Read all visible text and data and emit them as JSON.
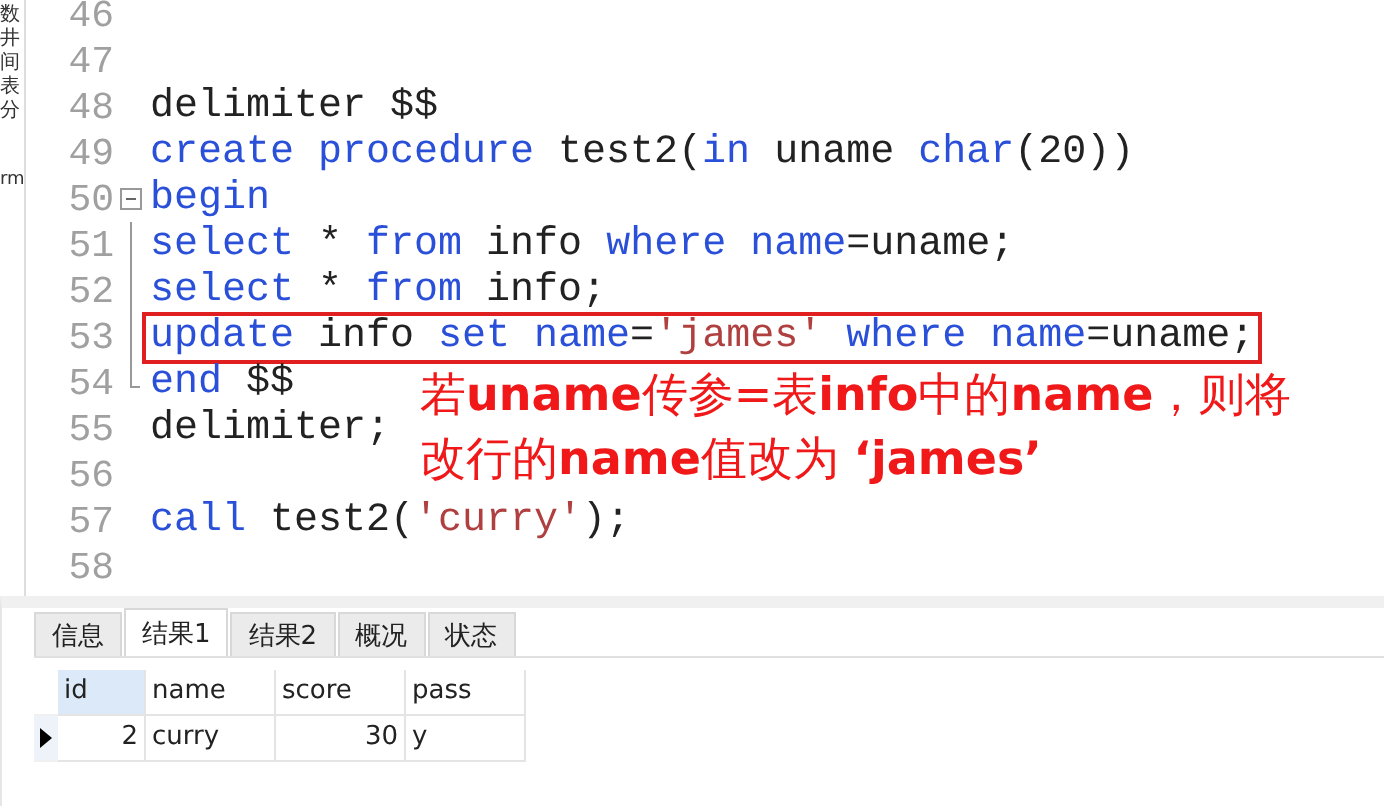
{
  "side_strip": [
    "数",
    "井",
    "间",
    "表",
    "分",
    "rm"
  ],
  "editor": {
    "lines": [
      {
        "number": "46"
      },
      {
        "number": "47"
      },
      {
        "number": "48",
        "tokens": [
          {
            "kind": "plain",
            "text": "delimiter $$"
          }
        ]
      },
      {
        "number": "49",
        "tokens": [
          {
            "kind": "keyword",
            "text": "create procedure"
          },
          {
            "kind": "plain",
            "text": " test2("
          },
          {
            "kind": "keyword",
            "text": "in"
          },
          {
            "kind": "plain",
            "text": " uname "
          },
          {
            "kind": "keyword",
            "text": "char"
          },
          {
            "kind": "plain",
            "text": "(20))"
          }
        ]
      },
      {
        "number": "50",
        "fold_start": true,
        "tokens": [
          {
            "kind": "keyword",
            "text": "begin"
          }
        ]
      },
      {
        "number": "51",
        "in_fold": true,
        "tokens": [
          {
            "kind": "keyword",
            "text": "select"
          },
          {
            "kind": "plain",
            "text": " * "
          },
          {
            "kind": "keyword",
            "text": "from"
          },
          {
            "kind": "plain",
            "text": " info "
          },
          {
            "kind": "keyword",
            "text": "where name"
          },
          {
            "kind": "plain",
            "text": "=uname;"
          }
        ]
      },
      {
        "number": "52",
        "in_fold": true,
        "tokens": [
          {
            "kind": "keyword",
            "text": "select"
          },
          {
            "kind": "plain",
            "text": " * "
          },
          {
            "kind": "keyword",
            "text": "from"
          },
          {
            "kind": "plain",
            "text": " info;"
          }
        ]
      },
      {
        "number": "53",
        "in_fold": true,
        "highlighted": true,
        "tokens": [
          {
            "kind": "keyword",
            "text": "update"
          },
          {
            "kind": "plain",
            "text": " info "
          },
          {
            "kind": "keyword",
            "text": "set name"
          },
          {
            "kind": "plain",
            "text": "="
          },
          {
            "kind": "string",
            "text": "'james'"
          },
          {
            "kind": "keyword",
            "text": " where name"
          },
          {
            "kind": "plain",
            "text": "=uname;"
          }
        ]
      },
      {
        "number": "54",
        "fold_end": true,
        "tokens": [
          {
            "kind": "keyword",
            "text": "end"
          },
          {
            "kind": "plain",
            "text": " $$"
          }
        ]
      },
      {
        "number": "55",
        "tokens": [
          {
            "kind": "plain",
            "text": "delimiter;"
          }
        ]
      },
      {
        "number": "56"
      },
      {
        "number": "57",
        "tokens": [
          {
            "kind": "keyword",
            "text": "call"
          },
          {
            "kind": "plain",
            "text": " test2("
          },
          {
            "kind": "string",
            "text": "'curry'"
          },
          {
            "kind": "plain",
            "text": ");"
          }
        ]
      },
      {
        "number": "58"
      }
    ]
  },
  "annotation": [
    "若**uname**传参=表**info**中的**name**，则将",
    "改行的**name**值改为 **‘james’**"
  ],
  "tabs": [
    {
      "label": "信息",
      "selected": false
    },
    {
      "label": "结果1",
      "selected": true
    },
    {
      "label": "结果2",
      "selected": false
    },
    {
      "label": "概况",
      "selected": false
    },
    {
      "label": "状态",
      "selected": false
    }
  ],
  "table": {
    "columns": [
      {
        "label": "id",
        "selected": true
      },
      {
        "label": "name",
        "selected": false
      },
      {
        "label": "score",
        "selected": false
      },
      {
        "label": "pass",
        "selected": false
      }
    ],
    "rows": [
      {
        "current": true,
        "cells": [
          "2",
          "curry",
          "30",
          "y"
        ]
      }
    ]
  }
}
